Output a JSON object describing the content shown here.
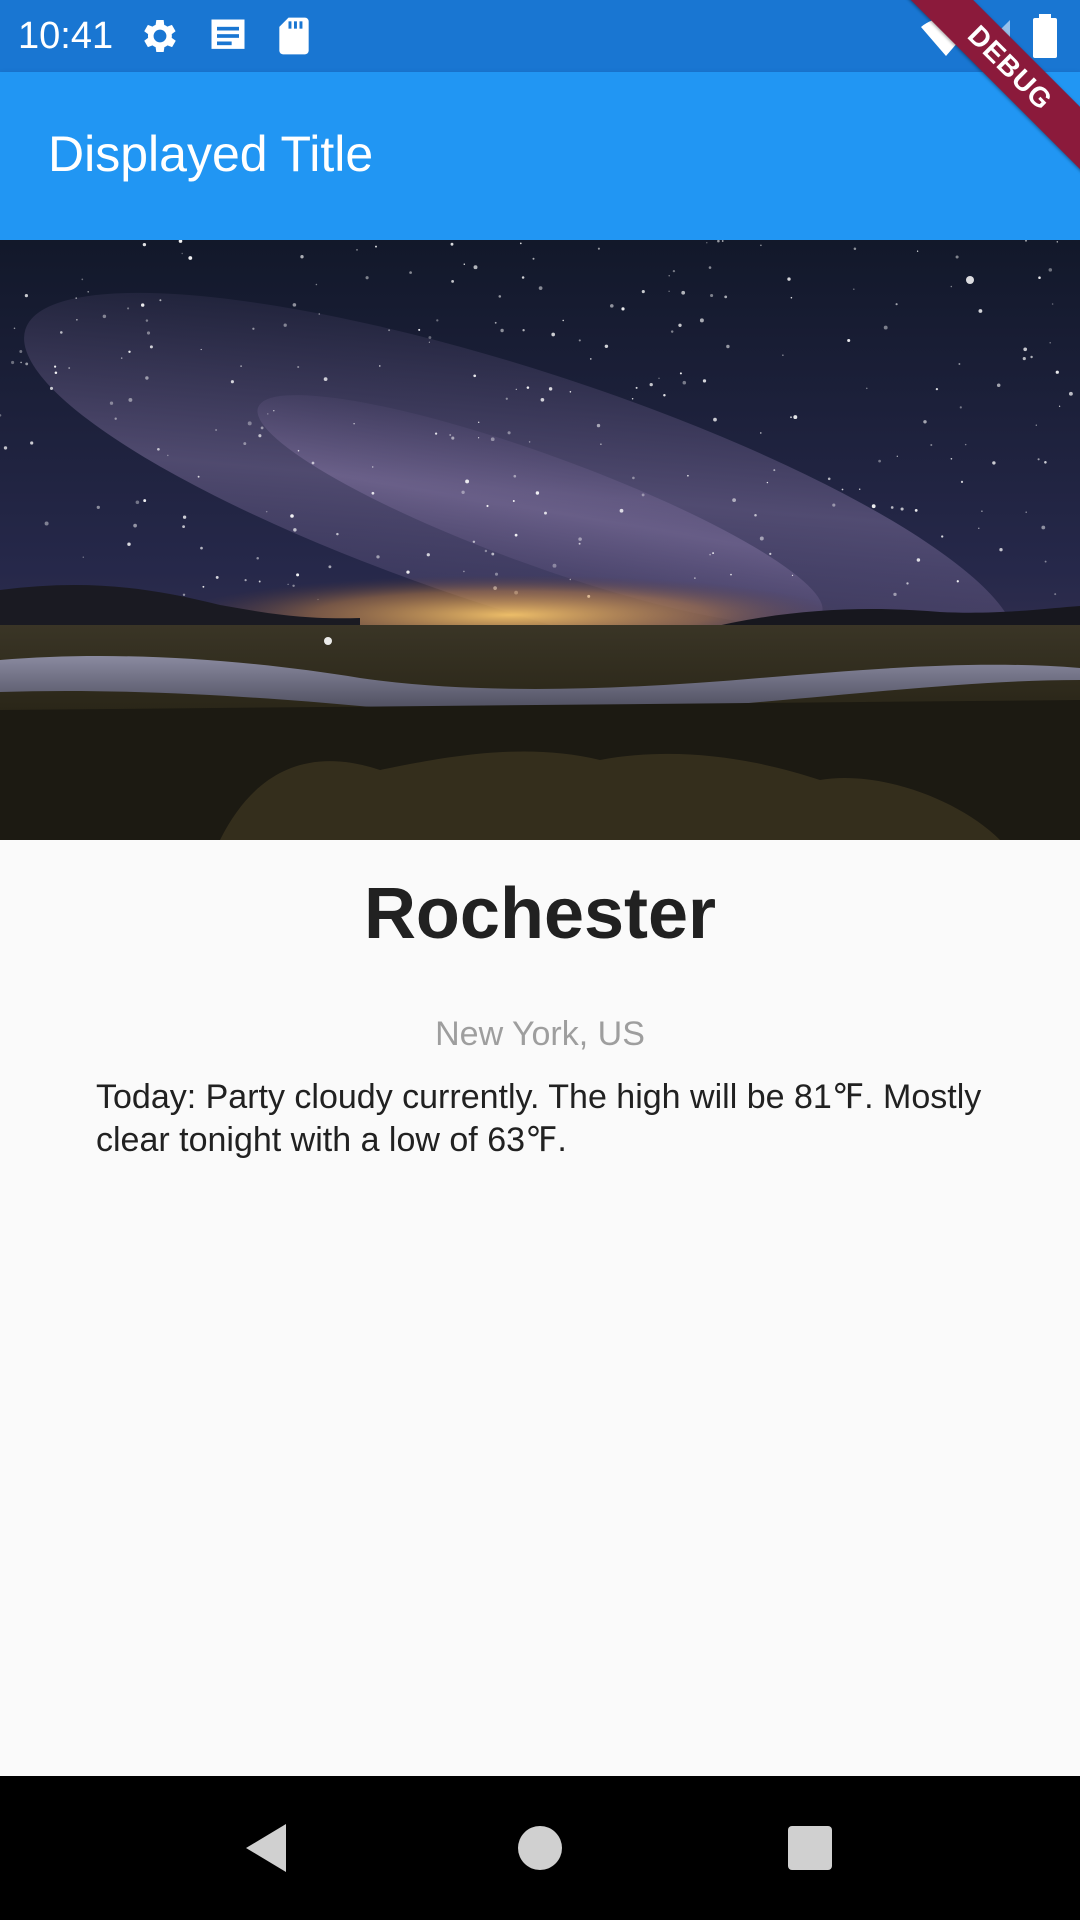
{
  "status_bar": {
    "time": "10:41",
    "left_icons": [
      "gear-icon",
      "message-icon",
      "sd-card-icon"
    ],
    "right_icons": [
      "wifi-icon",
      "cellular-signal-icon",
      "battery-icon"
    ]
  },
  "app_bar": {
    "title": "Displayed Title"
  },
  "debug_banner": {
    "label": "DEBUG"
  },
  "hero_image": {
    "description_icon": "night-sky-landscape-image"
  },
  "content": {
    "city": "Rochester",
    "region": "New York, US",
    "forecast": "Today: Party cloudy currently. The high will be 81℉. Mostly clear tonight with a low of 63℉."
  },
  "nav_bar": {
    "buttons": [
      "back-icon",
      "home-icon",
      "recents-icon"
    ]
  },
  "colors": {
    "status_bar": "#1976d2",
    "app_bar": "#2196f3",
    "debug_ribbon": "#8b1a3b",
    "background": "#fafafa"
  }
}
